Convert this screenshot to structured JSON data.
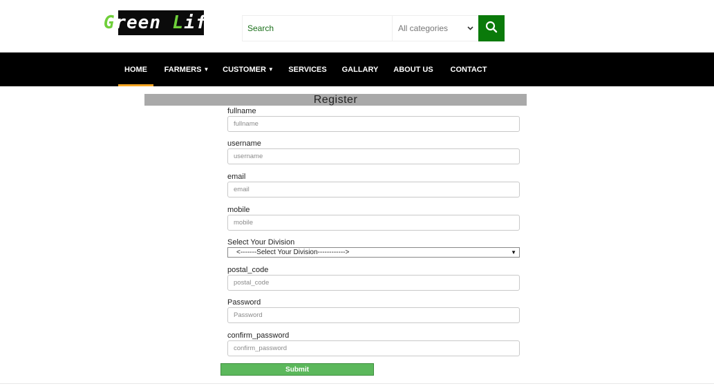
{
  "logo": {
    "part1_first": "G",
    "part1_rest": "reen ",
    "part2_first": "L",
    "part2_rest": "ife"
  },
  "search": {
    "placeholder": "Search",
    "category": "All categories"
  },
  "nav": {
    "home": "HOME",
    "farmers": "FARMERS",
    "customer": "CUSTOMER",
    "services": "SERVICES",
    "gallary": "GALLARY",
    "about": "ABOUT US",
    "contact": "CONTACT"
  },
  "form": {
    "title": "Register",
    "fullname": {
      "label": "fullname",
      "placeholder": "fullname",
      "value": ""
    },
    "username": {
      "label": "username",
      "placeholder": "username",
      "value": ""
    },
    "email": {
      "label": "email",
      "placeholder": "email",
      "value": ""
    },
    "mobile": {
      "label": "mobile",
      "placeholder": "mobile",
      "value": ""
    },
    "division": {
      "label": "Select Your Division",
      "selected": "<-------Select Your Division------------>"
    },
    "postal_code": {
      "label": "postal_code",
      "placeholder": "postal_code",
      "value": ""
    },
    "password": {
      "label": "Password",
      "placeholder": "Password",
      "value": ""
    },
    "confirm_password": {
      "label": "confirm_password",
      "placeholder": "confirm_password",
      "value": ""
    },
    "submit": "Submit"
  },
  "colors": {
    "accent_green": "#0a7a0a",
    "submit_green": "#5cb85c",
    "nav_bg": "#000000",
    "active_underline": "#f5a623",
    "register_bar": "#a9a9a9"
  },
  "icons": {
    "search": "search-icon",
    "category_dropdown": "chevron-down-icon",
    "nav_dropdown": "caret-down-icon",
    "division_dropdown": "triangle-down-icon"
  }
}
